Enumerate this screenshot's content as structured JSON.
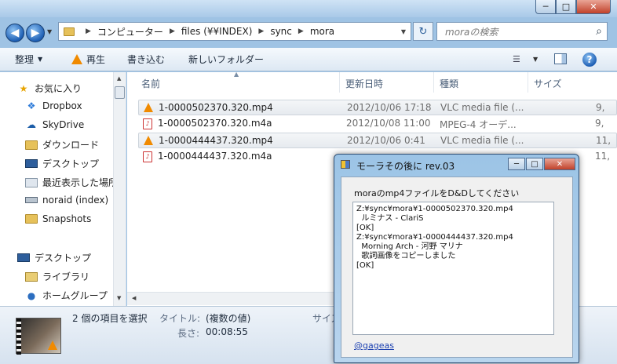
{
  "window": {
    "caption_min": "─",
    "caption_max": "□",
    "caption_close": "✕"
  },
  "nav": {
    "back": "◀",
    "forward": "▶",
    "breadcrumb": [
      "コンピューター",
      "files (¥¥INDEX)",
      "sync",
      "mora"
    ],
    "search_placeholder": "moraの検索"
  },
  "toolbar": {
    "organize": "整理",
    "play": "再生",
    "burn": "書き込む",
    "new_folder": "新しいフォルダー"
  },
  "sidebar": {
    "items": [
      {
        "label": "お気に入り",
        "icon": "star-icon"
      },
      {
        "label": "Dropbox",
        "icon": "dropbox-icon"
      },
      {
        "label": "SkyDrive",
        "icon": "skydrive-icon"
      },
      {
        "label": "ダウンロード",
        "icon": "folder-icon"
      },
      {
        "label": "デスクトップ",
        "icon": "desktop-icon"
      },
      {
        "label": "最近表示した場所",
        "icon": "recent-places-icon"
      },
      {
        "label": "noraid (index)",
        "icon": "network-drive-icon"
      },
      {
        "label": "Snapshots",
        "icon": "folder-icon"
      },
      {
        "label": "デスクトップ",
        "icon": "desktop-icon"
      },
      {
        "label": "ライブラリ",
        "icon": "library-icon"
      },
      {
        "label": "ホームグループ",
        "icon": "homegroup-icon"
      }
    ]
  },
  "files": {
    "columns": [
      "名前",
      "更新日時",
      "種類",
      "サイズ"
    ],
    "rows": [
      {
        "name": "1-0000502370.320.mp4",
        "date": "2012/10/06 17:18",
        "type": "VLC media file (...",
        "size": "9,",
        "kind": "mp4",
        "selected": true
      },
      {
        "name": "1-0000502370.320.m4a",
        "date": "2012/10/08 11:00",
        "type": "MPEG-4 オーデ...",
        "size": "9,",
        "kind": "m4a",
        "selected": false
      },
      {
        "name": "1-0000444437.320.mp4",
        "date": "2012/10/06 0:41",
        "type": "VLC media file (...",
        "size": "11,",
        "kind": "mp4",
        "selected": true
      },
      {
        "name": "1-0000444437.320.m4a",
        "date": "",
        "type": "",
        "size": "11,",
        "kind": "m4a",
        "selected": false
      }
    ]
  },
  "details": {
    "summary": "2 個の項目を選択",
    "title_label": "タイトル:",
    "title_value": "(複数の値)",
    "length_label": "長さ:",
    "length_value": "00:08:55",
    "size_label": "サイズ"
  },
  "dialog": {
    "title": "モーラその後に rev.03",
    "prompt": "moraのmp4ファイルをD&Dしてください",
    "log": [
      "Z:¥sync¥mora¥1-0000502370.320.mp4",
      "  ルミナス - ClariS",
      "[OK]",
      "Z:¥sync¥mora¥1-0000444437.320.mp4",
      "  Morning Arch - 河野 マリナ",
      "  歌詞画像をコピーしました",
      "[OK]"
    ],
    "link": "@gageas"
  }
}
